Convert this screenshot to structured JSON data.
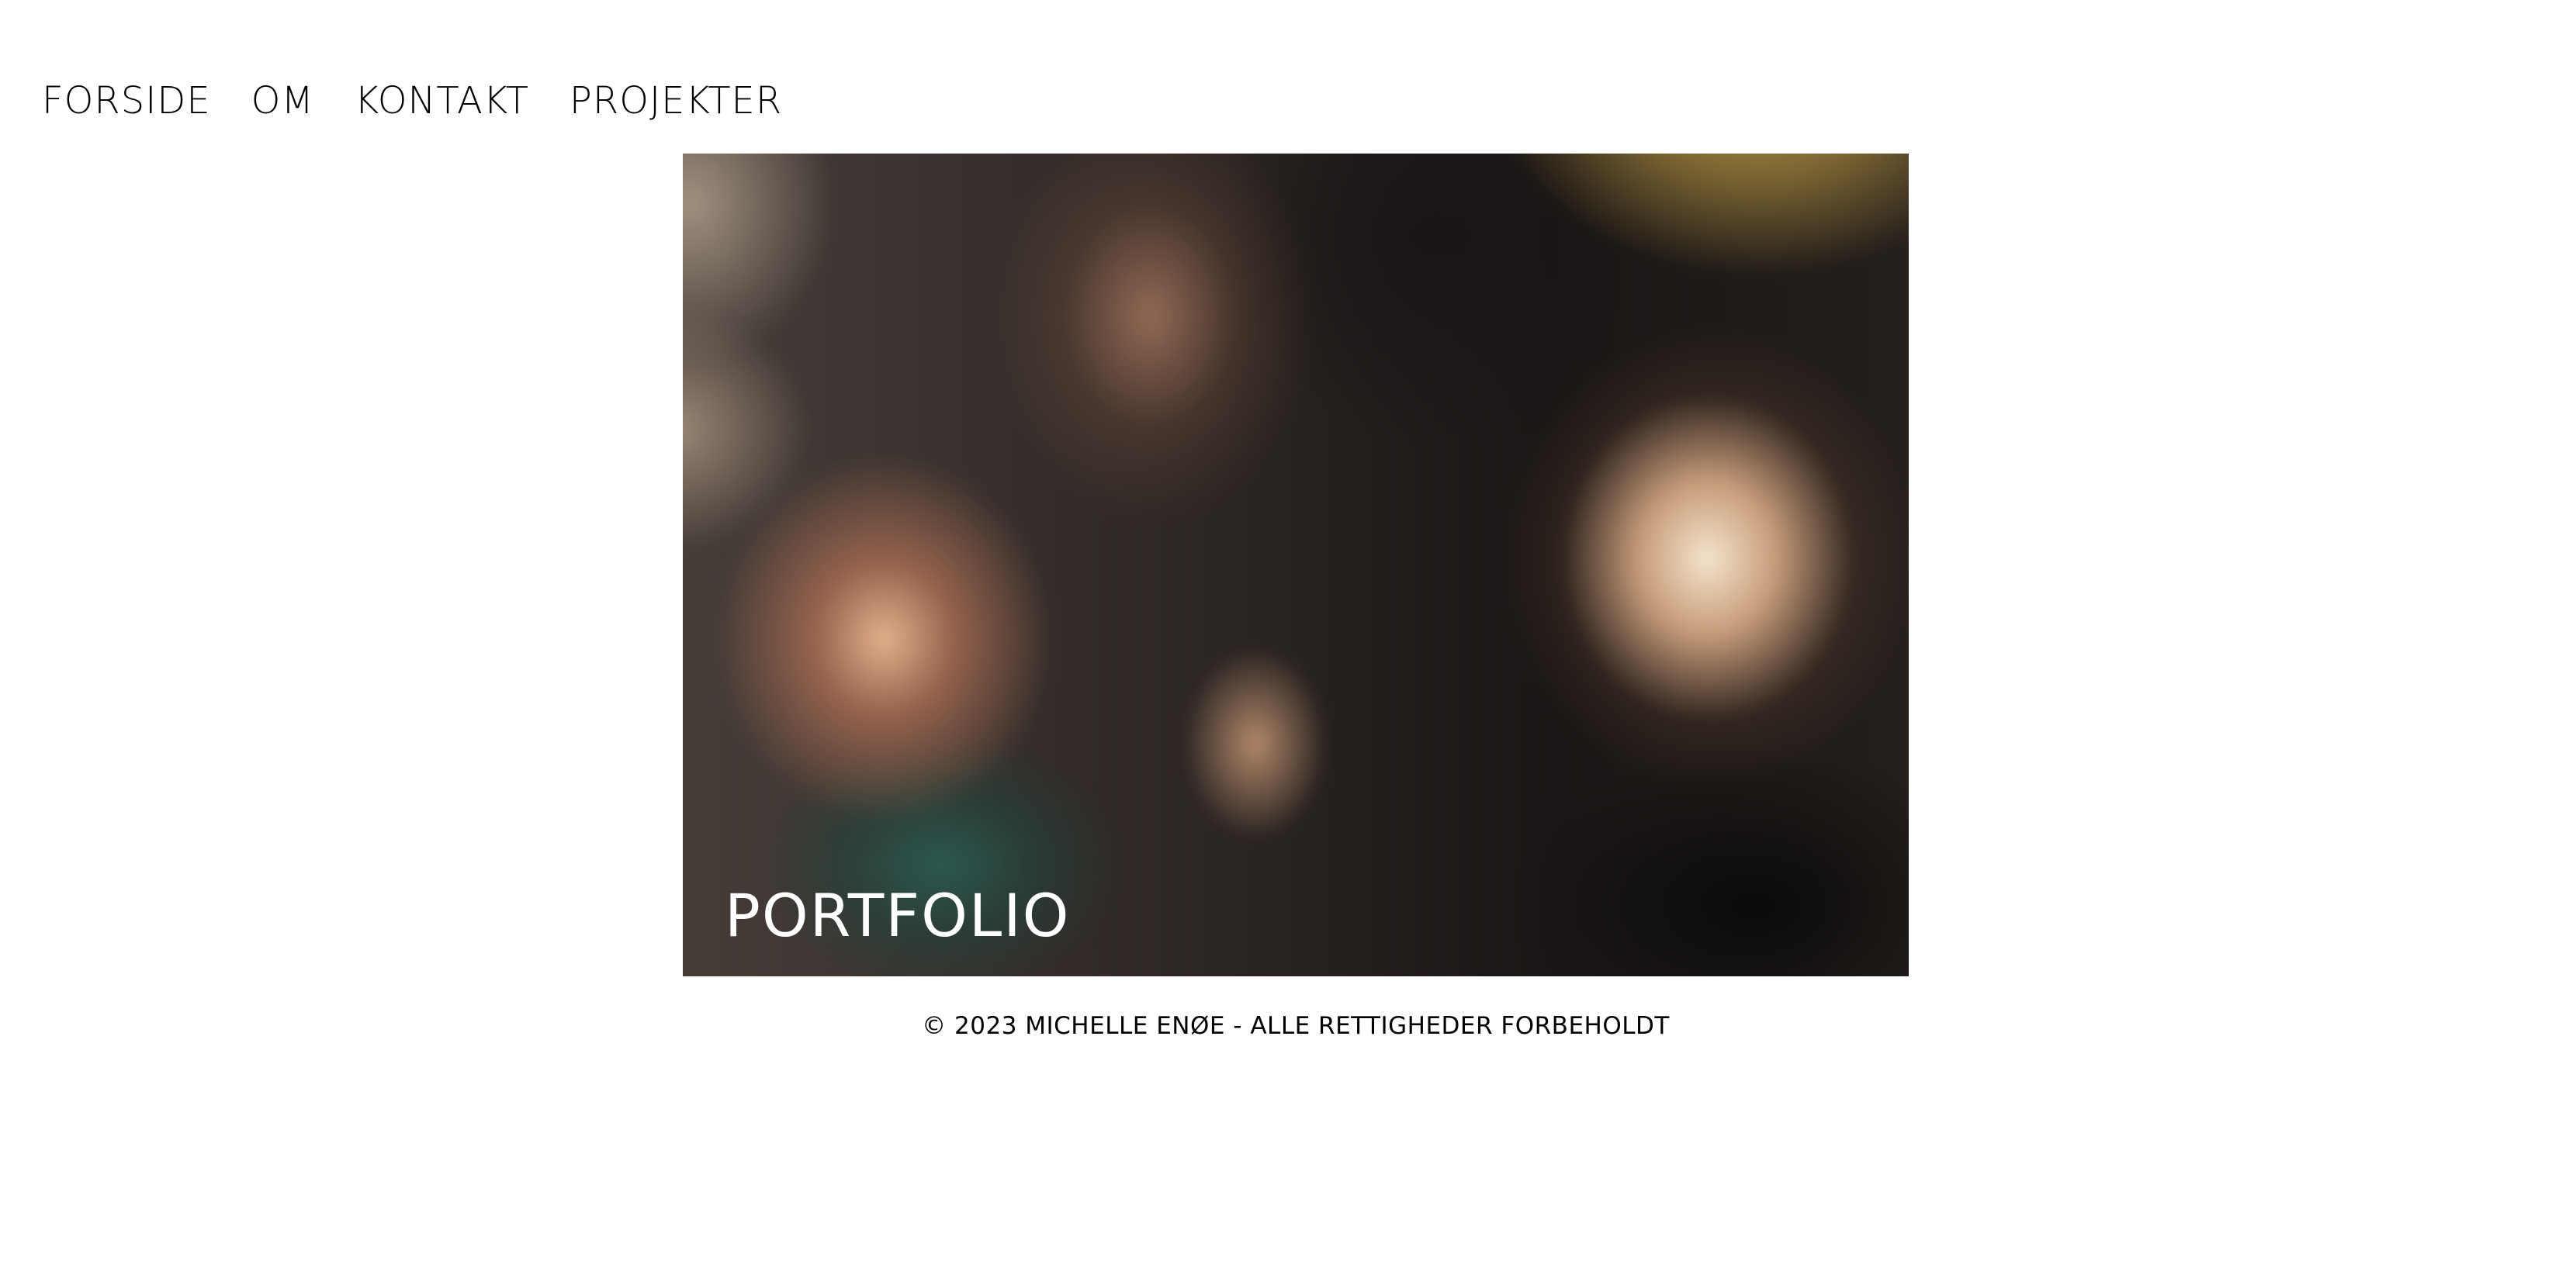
{
  "nav": {
    "items": [
      {
        "label": "FORSIDE"
      },
      {
        "label": "OM"
      },
      {
        "label": "KONTAKT"
      },
      {
        "label": "PROJEKTER"
      }
    ]
  },
  "hero": {
    "title": "PORTFOLIO",
    "image_description_icon": "blurred-party-photo"
  },
  "footer": {
    "copyright": "© 2023 MICHELLE ENØE - ALLE RETTIGHEDER FORBEHOLDT"
  },
  "colors": {
    "background": "#ffffff",
    "text": "#000000",
    "hero_text": "#ffffff"
  }
}
